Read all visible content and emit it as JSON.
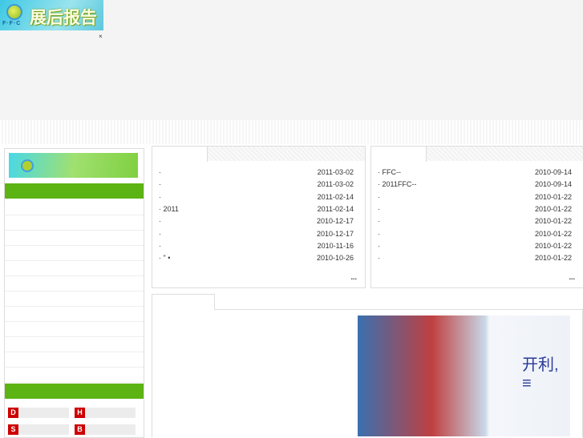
{
  "header": {
    "logo_text": "展后报告",
    "logo_sub": "F·F·C",
    "close": "×"
  },
  "news_left": {
    "items": [
      {
        "title": "·",
        "date": "2011-03-02"
      },
      {
        "title": "·",
        "date": "2011-03-02"
      },
      {
        "title": "·",
        "date": "2011-02-14"
      },
      {
        "title": "· 2011",
        "date": "2011-02-14"
      },
      {
        "title": "·",
        "date": "2010-12-17"
      },
      {
        "title": "·",
        "date": "2010-12-17"
      },
      {
        "title": "·",
        "date": "2010-11-16"
      },
      {
        "title": "·     \"   •",
        "date": "2010-10-26"
      }
    ],
    "more": "..."
  },
  "news_right": {
    "items": [
      {
        "title": "· FFC--",
        "date": "2010-09-14"
      },
      {
        "title": "· 2011FFC--",
        "date": "2010-09-14"
      },
      {
        "title": "·",
        "date": "2010-01-22"
      },
      {
        "title": "·",
        "date": "2010-01-22"
      },
      {
        "title": "·",
        "date": "2010-01-22"
      },
      {
        "title": "·",
        "date": "2010-01-22"
      },
      {
        "title": "·",
        "date": "2010-01-22"
      },
      {
        "title": "·",
        "date": "2010-01-22"
      }
    ],
    "more": "..."
  },
  "sidebar": {
    "badges": [
      "D",
      "H",
      "S",
      "B"
    ]
  },
  "photo": {
    "sign_text": "开利, ≡"
  }
}
